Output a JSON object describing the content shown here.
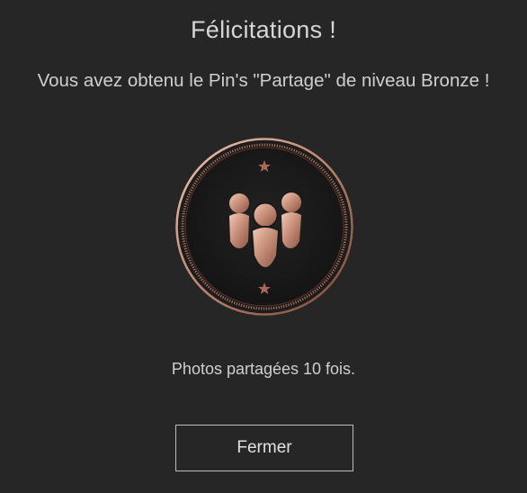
{
  "dialog": {
    "title": "Félicitations !",
    "message": "Vous avez obtenu le Pin's \"Partage\" de niveau Bronze !",
    "achievement_text": "Photos partagées 10 fois.",
    "close_label": "Fermer"
  },
  "badge": {
    "icon": "people-group-icon",
    "level": "Bronze",
    "colors": {
      "bronze_light": "#e8b8a3",
      "bronze_mid": "#b57a64",
      "bronze_dark": "#6e3f31",
      "face": "#1b1a1a",
      "background": "#262626"
    }
  }
}
